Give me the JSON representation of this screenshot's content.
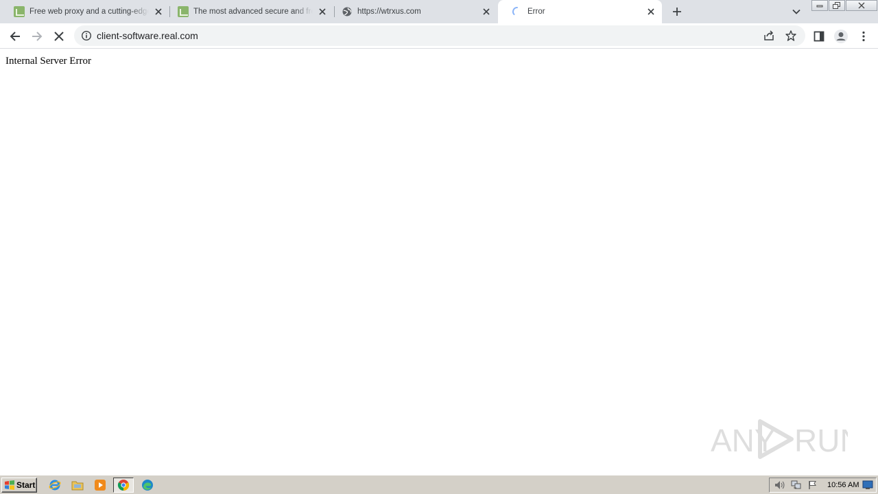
{
  "browser": {
    "tabs": [
      {
        "title": "Free web proxy and a cutting-edge online proxy",
        "favicon": "proxy-site-icon",
        "active": false
      },
      {
        "title": "The most advanced secure and free web proxy",
        "favicon": "proxy-site-icon",
        "active": false
      },
      {
        "title": "https://wtrxus.com",
        "favicon": "globe-icon",
        "active": false
      },
      {
        "title": "Error",
        "favicon": "loading-spinner-icon",
        "active": true
      }
    ],
    "address": "client-software.real.com"
  },
  "page": {
    "body_text": "Internal Server Error"
  },
  "watermark": {
    "text_left": "ANY",
    "text_right": "RUN"
  },
  "taskbar": {
    "start_label": "Start",
    "clock": "10:56 AM"
  },
  "colors": {
    "tabstrip_bg": "#dee1e6",
    "omnibox_bg": "#f1f3f4",
    "taskbar_bg": "#d4d0c8",
    "proxy_favicon": "#8ab56b",
    "spinner": "#8ab4f8"
  }
}
